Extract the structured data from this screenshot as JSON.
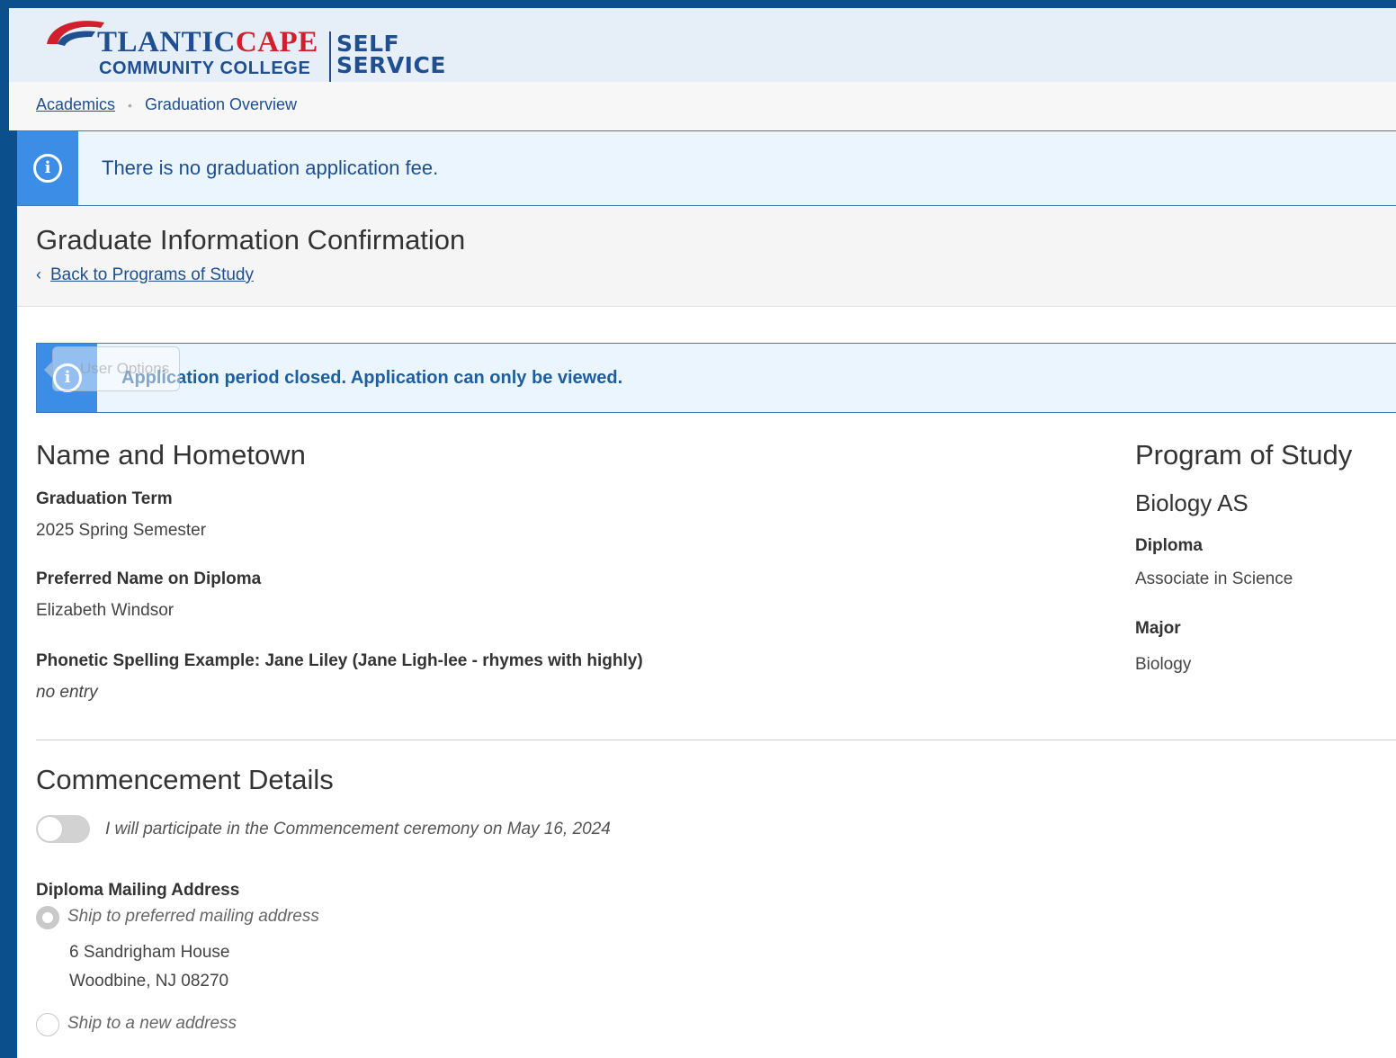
{
  "header": {
    "logo": {
      "atlantic": "TLANTIC",
      "cape": "CAPE",
      "community_college": "COMMUNITY COLLEGE",
      "self": "SELF",
      "service": "SERVICE"
    }
  },
  "breadcrumb": {
    "academics": "Academics",
    "current": "Graduation Overview"
  },
  "alerts": {
    "fee": "There is no graduation application fee.",
    "closed": "Application period closed. Application can only be viewed."
  },
  "user_options_label": "User Options",
  "page": {
    "title": "Graduate Information Confirmation",
    "back_link": "Back to Programs of Study"
  },
  "name_section": {
    "heading": "Name and Hometown",
    "graduation_term_label": "Graduation Term",
    "graduation_term_value": "2025 Spring Semester",
    "preferred_name_label": "Preferred Name on Diploma",
    "preferred_name_value": "Elizabeth Windsor",
    "phonetic_label": "Phonetic Spelling Example: Jane Liley (Jane Ligh-lee - rhymes with highly)",
    "phonetic_value": "no entry"
  },
  "program_section": {
    "heading": "Program of Study",
    "program_name": "Biology AS",
    "diploma_label": "Diploma",
    "diploma_value": "Associate in Science",
    "major_label": "Major",
    "major_value": "Biology"
  },
  "commencement": {
    "heading": "Commencement Details",
    "participate_label": "I will participate in the Commencement ceremony on May 16, 2024",
    "participate_on": false,
    "mailing_label": "Diploma Mailing Address",
    "option_preferred": "Ship to preferred mailing address",
    "address_line1": "6 Sandrigham House",
    "address_line2": "Woodbine, NJ 08270",
    "option_new": "Ship to a new address",
    "selected_option": "preferred"
  },
  "colors": {
    "brand_blue": "#1f4f8f",
    "brand_red": "#d0202e",
    "alert_icon_bg": "#3c8de6",
    "alert_bg": "#eaf5fd",
    "frame_blue": "#0b4f8c"
  },
  "icons": {
    "alert": "info-circle-icon",
    "back": "chevron-left-icon"
  }
}
